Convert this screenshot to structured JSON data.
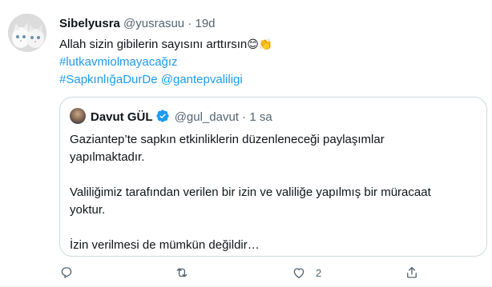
{
  "tweet": {
    "user_name": "Sibelyusra",
    "handle": "@yusrasuu",
    "separator": "·",
    "time": "19d",
    "text_line1": "Allah sizin gibilerin sayısını arttırsın",
    "emojis": "😊👏",
    "hashtag1": "#lutkavmiolmayacağız",
    "hashtag2": "#SapkınlığaDurDe",
    "mention": "@gantepvaliligi"
  },
  "quoted": {
    "user_name": "Davut GÜL",
    "handle": "@gul_davut",
    "separator": "·",
    "time": "1 sa",
    "para1_line1": "Gaziantep’te sapkın etkinliklerin düzenleneceği  paylaşımlar",
    "para1_line2": "yapılmaktadır.",
    "para2_line1": "Valiliğimiz tarafından verilen bir izin ve  valiliğe yapılmış bir müracaat",
    "para2_line2": "yoktur.",
    "para3_line1": "İzin verilmesi de mümkün değildir…"
  },
  "actions": {
    "reply_count": "",
    "retweet_count": "",
    "like_count": "2",
    "share_count": ""
  },
  "colors": {
    "accent": "#1d9bf0",
    "muted": "#536471",
    "border": "#cfd9de"
  },
  "icons": [
    "reply-icon",
    "retweet-icon",
    "like-icon",
    "share-icon",
    "verified-badge-icon"
  ]
}
